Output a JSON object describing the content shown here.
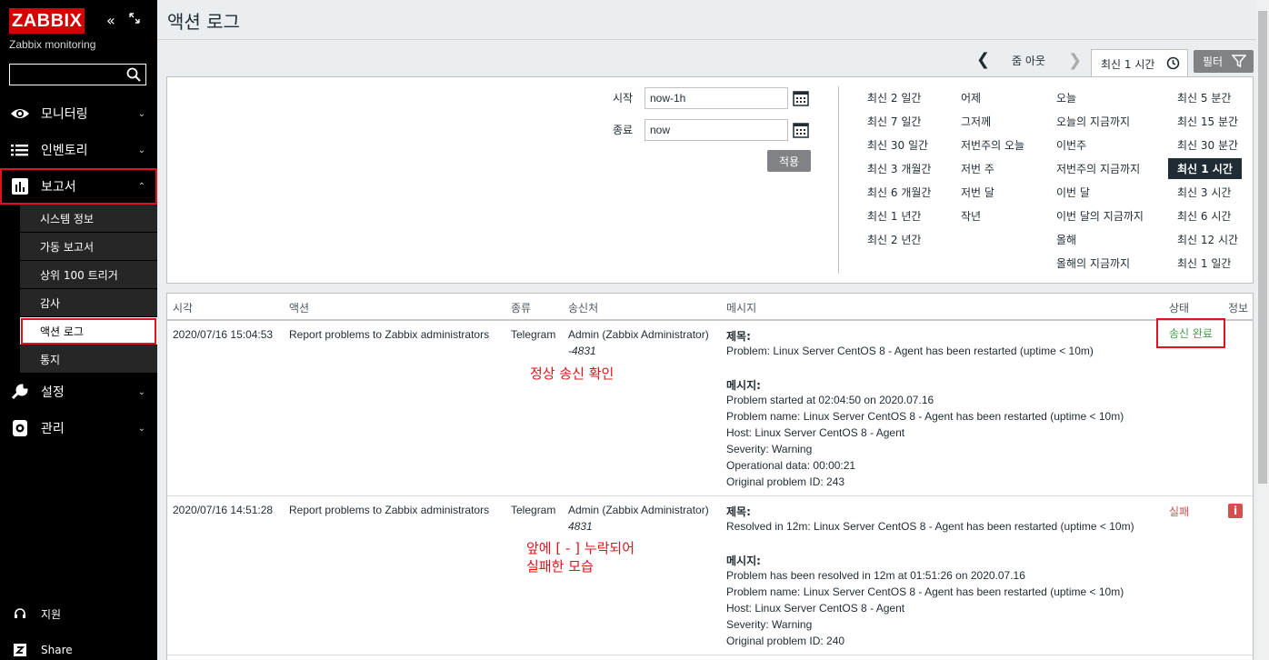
{
  "sidebar": {
    "logo": "ZABBIX",
    "subtitle": "Zabbix monitoring",
    "search_value": "",
    "menu": [
      {
        "label": "모니터링",
        "icon": "eye-icon"
      },
      {
        "label": "인벤토리",
        "icon": "list-icon"
      },
      {
        "label": "보고서",
        "icon": "bar-chart-icon"
      }
    ],
    "reports_submenu": [
      "시스템 정보",
      "가동 보고서",
      "상위 100 트리거",
      "감사",
      "액션 로그",
      "통지"
    ],
    "menu_lower": [
      {
        "label": "설정",
        "icon": "wrench-icon"
      },
      {
        "label": "관리",
        "icon": "gear-icon"
      }
    ],
    "support": "지원",
    "share": "Share"
  },
  "header": {
    "title": "액션 로그",
    "zoom_out": "줌 아웃",
    "current_range": "최신 1 시간",
    "filter_label": "필터"
  },
  "filter": {
    "from_label": "시작",
    "from_value": "now-1h",
    "to_label": "종료",
    "to_value": "now",
    "apply_label": "적용",
    "quick": {
      "col1": [
        "최신 2 일간",
        "최신 7 일간",
        "최신 30 일간",
        "최신 3 개월간",
        "최신 6 개월간",
        "최신 1 년간",
        "최신 2 년간"
      ],
      "col2": [
        "어제",
        "그저께",
        "저번주의 오늘",
        "저번 주",
        "저번 달",
        "작년"
      ],
      "col3": [
        "오늘",
        "오늘의 지금까지",
        "이번주",
        "저번주의 지금까지",
        "이번 달",
        "이번 달의 지금까지",
        "올해",
        "올해의 지금까지"
      ],
      "col4": [
        "최신 5 분간",
        "최신 15 분간",
        "최신 30 분간",
        "최신 1 시간",
        "최신 3 시간",
        "최신 6 시간",
        "최신 12 시간",
        "최신 1 일간"
      ]
    }
  },
  "table": {
    "headers": [
      "시각",
      "액션",
      "종류",
      "송신처",
      "메시지",
      "상태",
      "정보"
    ],
    "rows": [
      {
        "time": "2020/07/16 15:04:53",
        "action": "Report problems to Zabbix administrators",
        "type": "Telegram",
        "recipient": "Admin (Zabbix Administrator)",
        "recipient_id": "-4831",
        "subject_label": "제목:",
        "subject": "Problem: Linux Server CentOS 8 - Agent has been restarted (uptime < 10m)",
        "message_label": "메시지:",
        "message_lines": [
          "Problem started at 02:04:50 on 2020.07.16",
          "Problem name: Linux Server CentOS 8 - Agent has been restarted (uptime < 10m)",
          "Host: Linux Server CentOS 8 - Agent",
          "Severity: Warning",
          "Operational data: 00:00:21",
          "Original problem ID: 243"
        ],
        "status": "송신 완료",
        "annotation": "정상 송신 확인"
      },
      {
        "time": "2020/07/16 14:51:28",
        "action": "Report problems to Zabbix administrators",
        "type": "Telegram",
        "recipient": "Admin (Zabbix Administrator)",
        "recipient_id": "4831",
        "subject_label": "제목:",
        "subject": "Resolved in 12m: Linux Server CentOS 8 - Agent has been restarted (uptime < 10m)",
        "message_label": "메시지:",
        "message_lines": [
          "Problem has been resolved in 12m at 01:51:26 on 2020.07.16",
          "Problem name: Linux Server CentOS 8 - Agent has been restarted (uptime < 10m)",
          "Host: Linux Server CentOS 8 - Agent",
          "Severity: Warning",
          "Original problem ID: 240"
        ],
        "status": "실패",
        "info": "i",
        "annotation_line1": "앞에 [ - ] 누락되어",
        "annotation_line2": "실패한 모습"
      }
    ]
  },
  "colors": {
    "brand": "#d40000",
    "highlight": "#e0141e",
    "ok": "#429e47",
    "fail": "#d64e4e"
  }
}
